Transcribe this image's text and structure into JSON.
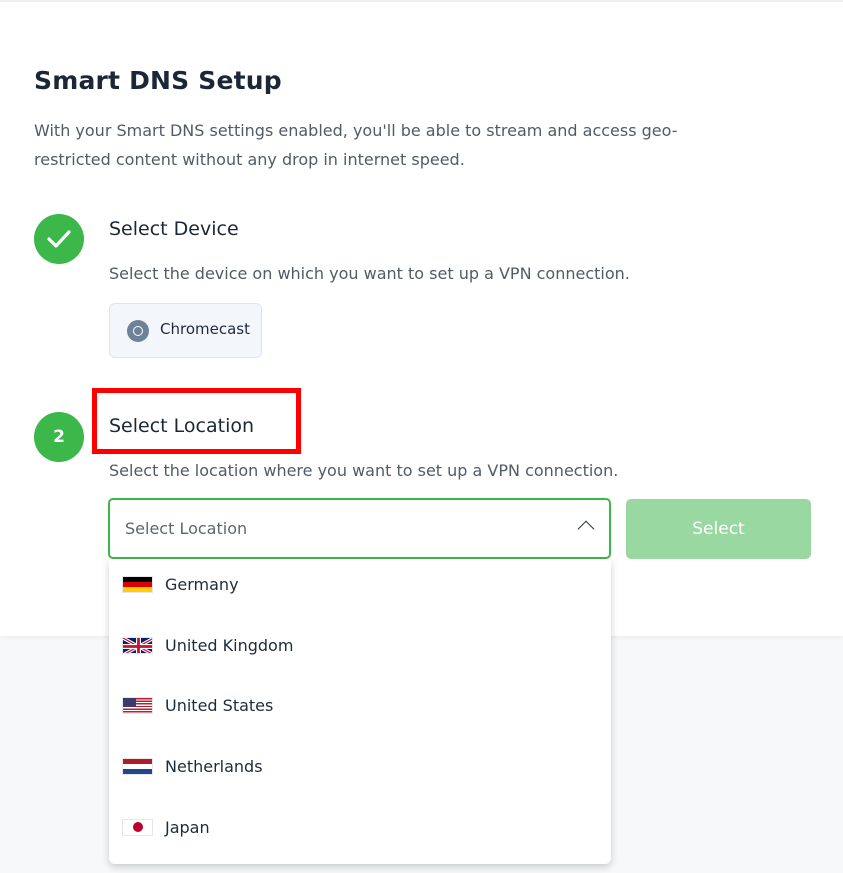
{
  "page": {
    "title": "Smart DNS Setup",
    "description": "With your Smart DNS settings enabled, you'll be able to stream and access geo-restricted content without any drop in internet speed."
  },
  "step1": {
    "status": "completed",
    "heading": "Select Device",
    "description": "Select the device on which you want to set up a VPN connection.",
    "selected_device": "Chromecast"
  },
  "step2": {
    "number": "2",
    "heading": "Select Location",
    "description": "Select the location where you want to set up a VPN connection.",
    "location_placeholder": "Select Location",
    "button_label": "Select",
    "dropdown_open": true
  },
  "location_options": [
    {
      "label": "Germany",
      "flag": "flag-germany"
    },
    {
      "label": "United Kingdom",
      "flag": "flag-united-kingdom"
    },
    {
      "label": "United States",
      "flag": "flag-united-states"
    },
    {
      "label": "Netherlands",
      "flag": "flag-netherlands"
    },
    {
      "label": "Japan",
      "flag": "flag-japan"
    }
  ],
  "colors": {
    "accent_green": "#3cb84a",
    "disabled_button": "#9ad8a2",
    "highlight_red": "#ff0000"
  }
}
